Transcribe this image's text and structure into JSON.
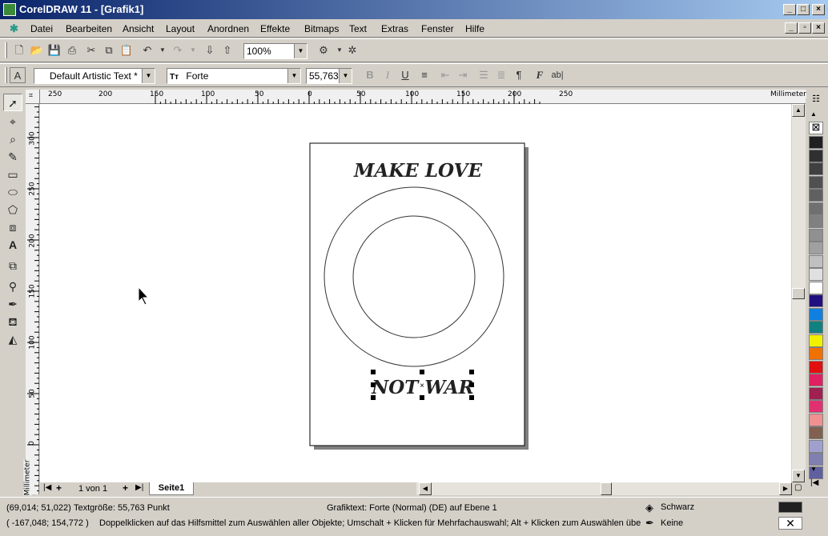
{
  "window": {
    "title": "CorelDRAW 11 - [Grafik1]"
  },
  "menu": [
    "Datei",
    "Bearbeiten",
    "Ansicht",
    "Layout",
    "Anordnen",
    "Effekte",
    "Bitmaps",
    "Text",
    "Extras",
    "Fenster",
    "Hilfe"
  ],
  "standard_toolbar": {
    "zoom": "100%"
  },
  "property_bar": {
    "style": "Default Artistic Text *",
    "font": "Forte",
    "font_size": "55,763",
    "font_icon": "Tт",
    "bold": "B",
    "italic": "I",
    "underline": "U",
    "char_format": "F",
    "edit_text": "ab|"
  },
  "rulers": {
    "h_ticks": [
      "250",
      "200",
      "150",
      "100",
      "50",
      "0",
      "50",
      "100",
      "150",
      "200",
      "250"
    ],
    "h_unit": "Millimeter",
    "v_ticks": [
      "300",
      "250",
      "200",
      "150",
      "100",
      "50",
      "0"
    ],
    "v_unit": "Millimeter"
  },
  "canvas": {
    "text_top": "MAKE LOVE",
    "text_bottom": "NOT WAR"
  },
  "page_nav": {
    "page_count": "1 von 1",
    "page_tab": "Seite1"
  },
  "palette_colors": [
    "#202020",
    "#303030",
    "#404040",
    "#505050",
    "#606060",
    "#707070",
    "#808080",
    "#909090",
    "#a0a0a0",
    "#c0c0c0",
    "#e0e0e0",
    "#ffffff",
    "#201080",
    "#1080e0",
    "#108080",
    "#f0f000",
    "#f07000",
    "#e01010",
    "#e02060",
    "#a02050",
    "#e03070",
    "#f09090",
    "#806050",
    "#a0a0d0",
    "#8080b0",
    "#6060a0"
  ],
  "status": {
    "coords": "(69,014; 51,022)",
    "text_size": "Textgröße: 55,763 Punkt",
    "object_info": "Grafiktext: Forte (Normal) (DE) auf Ebene 1",
    "fill_label": "Schwarz",
    "outline_label": "Keine",
    "cursor_coords": "( -167,048; 154,772 )",
    "hint": "Doppelklicken auf das Hilfsmittel zum Auswählen aller Objekte; Umschalt + Klicken für Mehrfachauswahl; Alt + Klicken zum Auswählen überde..."
  }
}
